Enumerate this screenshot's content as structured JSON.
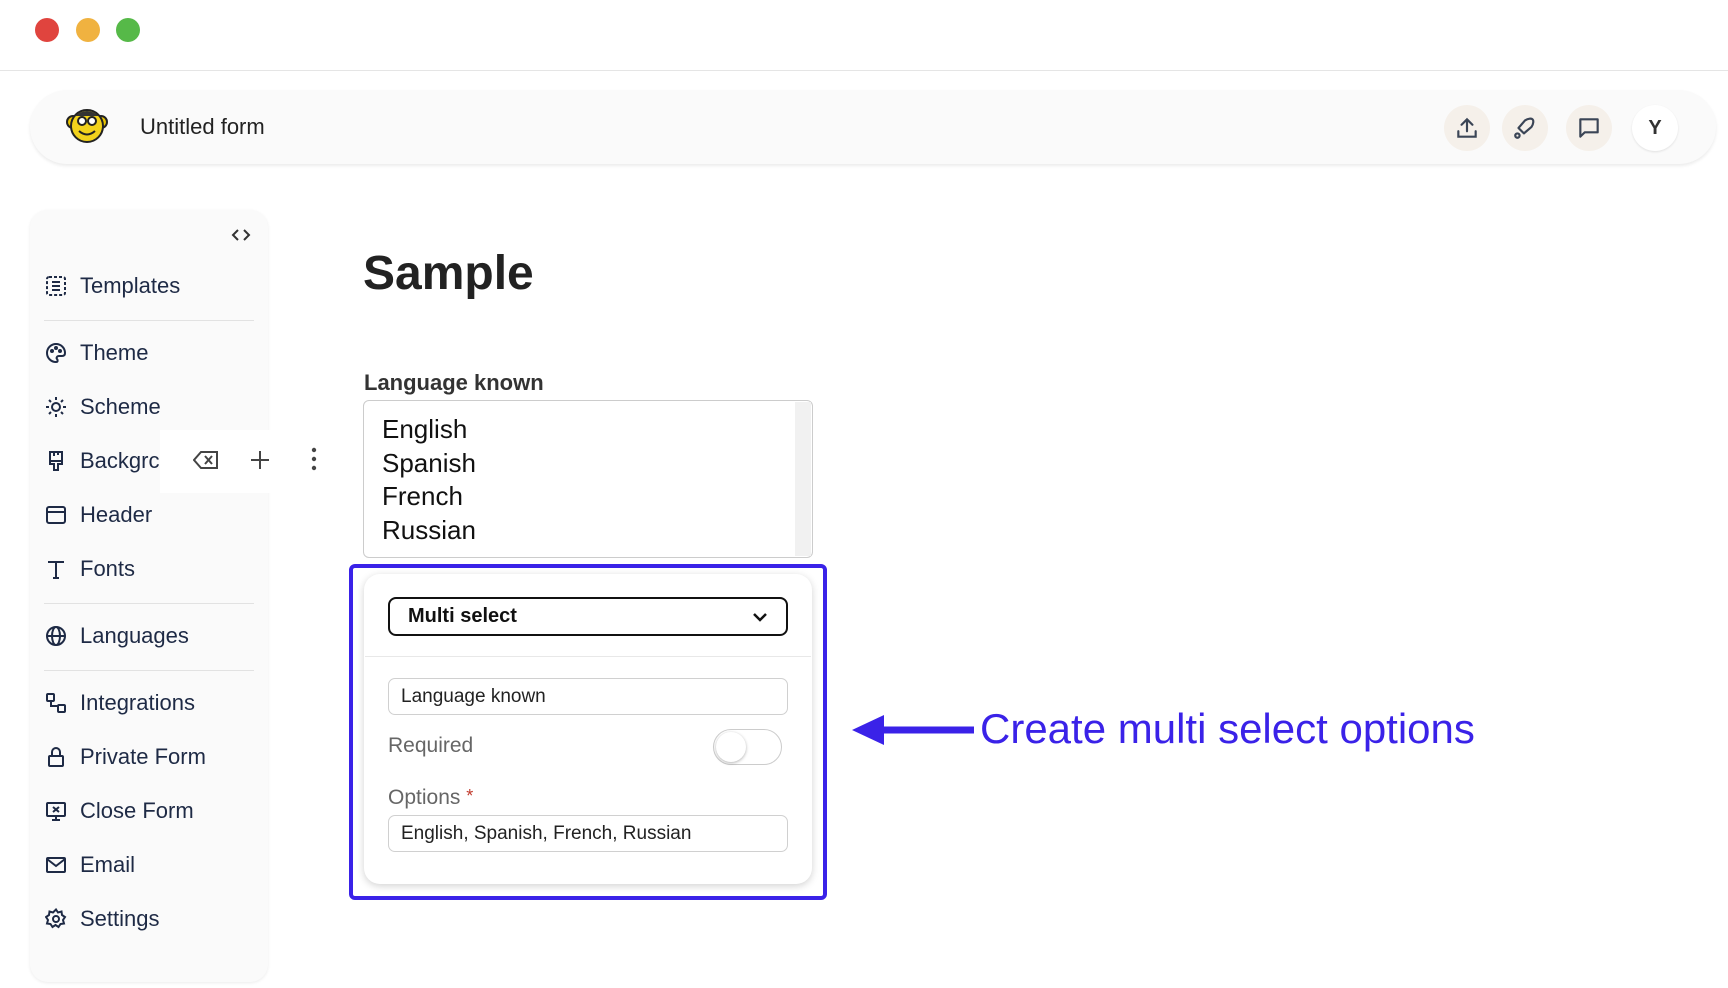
{
  "window": {
    "controls": [
      "close",
      "minimize",
      "maximize"
    ],
    "colors": {
      "close": "#e0443e",
      "minimize": "#f0b240",
      "maximize": "#56b948"
    }
  },
  "header": {
    "title": "Untitled form",
    "logo": "monkey-logo",
    "actions": [
      {
        "icon": "upload-icon"
      },
      {
        "icon": "rocket-icon"
      },
      {
        "icon": "chat-icon"
      }
    ],
    "avatar": "Y"
  },
  "sidebar": {
    "items": [
      {
        "label": "Templates",
        "icon": "templates-icon"
      },
      {
        "label": "Theme",
        "icon": "palette-icon"
      },
      {
        "label": "Scheme",
        "icon": "sun-moon-icon"
      },
      {
        "label": "Backgrc",
        "icon": "brush-icon"
      },
      {
        "label": "Header",
        "icon": "header-icon"
      },
      {
        "label": "Fonts",
        "icon": "type-icon"
      },
      {
        "label": "Languages",
        "icon": "globe-icon"
      },
      {
        "label": "Integrations",
        "icon": "integrations-icon"
      },
      {
        "label": "Private Form",
        "icon": "lock-icon"
      },
      {
        "label": "Close Form",
        "icon": "close-form-icon"
      },
      {
        "label": "Email",
        "icon": "mail-icon"
      },
      {
        "label": "Settings",
        "icon": "gear-icon"
      }
    ]
  },
  "form": {
    "title": "Sample",
    "field_label": "Language known",
    "options_list": [
      "English",
      "Spanish",
      "French",
      "Russian"
    ]
  },
  "editor": {
    "type_select": "Multi select",
    "label_value": "Language known",
    "required_label": "Required",
    "required_on": false,
    "options_label": "Options",
    "required_mark": "*",
    "options_value": "English, Spanish, French, Russian"
  },
  "annotation": {
    "text": "Create multi select options",
    "color": "#3a22e8"
  }
}
